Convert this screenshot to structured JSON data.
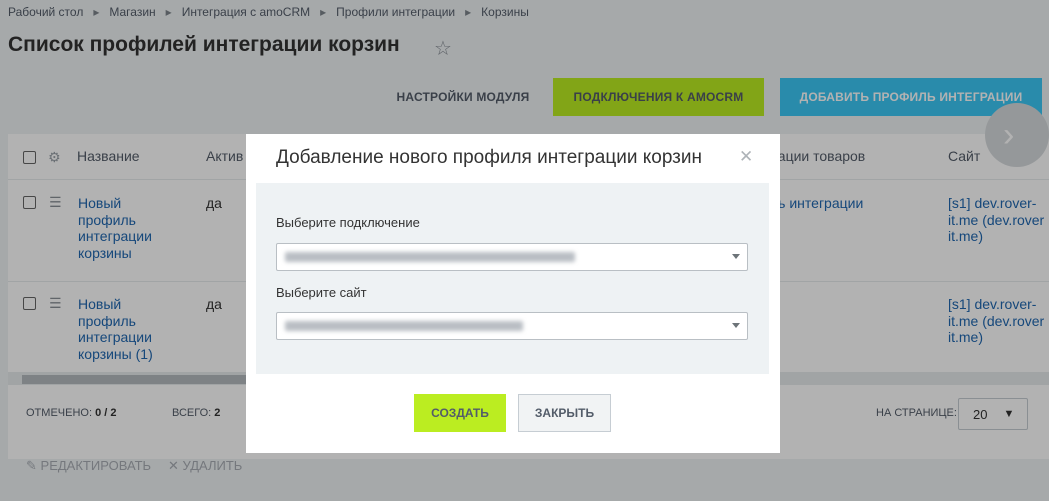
{
  "breadcrumb": [
    "Рабочий стол",
    "Магазин",
    "Интеграция с amoCRM",
    "Профили интеграции",
    "Корзины"
  ],
  "breadcrumb_sep": "▸",
  "page_title": "Список профилей интеграции корзин",
  "toolbar": {
    "settings_label": "НАСТРОЙКИ МОДУЛЯ",
    "connections_label": "ПОДКЛЮЧЕНИЯ К AMOCRM",
    "add_profile_label": "ДОБАВИТЬ ПРОФИЛЬ ИНТЕГРАЦИИ"
  },
  "grid": {
    "columns": [
      "Название",
      "Актив",
      "рации товаров",
      "Сайт"
    ],
    "rows": [
      {
        "name": "Новый\nпрофиль\nинтеграции\nкорзины",
        "active": "да",
        "product_integration": "ль интеграции",
        "site": "[s1] dev.rover-\nit.me (dev.rover\nit.me)"
      },
      {
        "name": "Новый\nпрофиль\nинтеграции\nкорзины (1)",
        "active": "да",
        "product_integration": "",
        "site": "[s1] dev.rover-\nit.me (dev.rover\nit.me)"
      }
    ],
    "footer": {
      "selected_label": "ОТМЕЧЕНО:",
      "selected_value": "0 / 2",
      "total_label": "ВСЕГО:",
      "total_value": "2",
      "per_page_label": "НА СТРАНИЦЕ:",
      "per_page_value": "20"
    }
  },
  "actions": {
    "edit_label": "РЕДАКТИРОВАТЬ",
    "delete_label": "УДАЛИТЬ"
  },
  "dialog": {
    "title": "Добавление нового профиля интеграции корзин",
    "connection_label": "Выберите подключение",
    "site_label": "Выберите сайт",
    "create_label": "СОЗДАТЬ",
    "close_label": "ЗАКРЫТЬ"
  },
  "colors": {
    "accent_green": "#bbed21",
    "accent_blue": "#3bc8f5",
    "link": "#2067b0"
  },
  "icons": {
    "star": "star-icon",
    "gear": "gear-icon",
    "menu": "hamburger-icon",
    "close": "close-icon",
    "pencil": "pencil-icon",
    "delete": "cross-icon",
    "next": "chevron-right-icon"
  }
}
